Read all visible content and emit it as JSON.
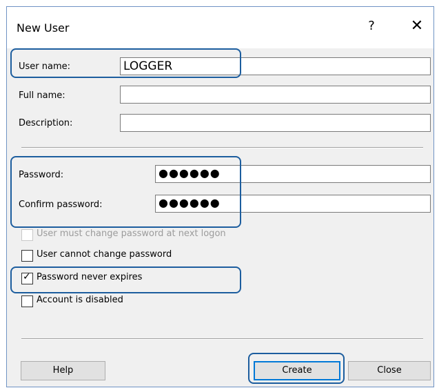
{
  "window": {
    "title": "New User",
    "help_glyph": "?",
    "close_glyph": "✕"
  },
  "form": {
    "user_name_label": "User name:",
    "user_name_value": "LOGGER",
    "full_name_label": "Full name:",
    "full_name_value": "",
    "description_label": "Description:",
    "description_value": "",
    "password_label": "Password:",
    "password_value": "●●●●●●",
    "confirm_label": "Confirm password:",
    "confirm_value": "●●●●●●"
  },
  "options": [
    {
      "label": "User must change password at next logon",
      "checked": false,
      "enabled": false
    },
    {
      "label": "User cannot change password",
      "checked": false,
      "enabled": true
    },
    {
      "label": "Password never expires",
      "checked": true,
      "enabled": true
    },
    {
      "label": "Account is disabled",
      "checked": false,
      "enabled": true
    }
  ],
  "check_glyph": "✓",
  "buttons": {
    "help": "Help",
    "create": "Create",
    "close": "Close"
  },
  "colors": {
    "highlight": "#1c5d9e",
    "dialog_bg": "#f0f0f0",
    "default_button_border": "#0078d7"
  }
}
